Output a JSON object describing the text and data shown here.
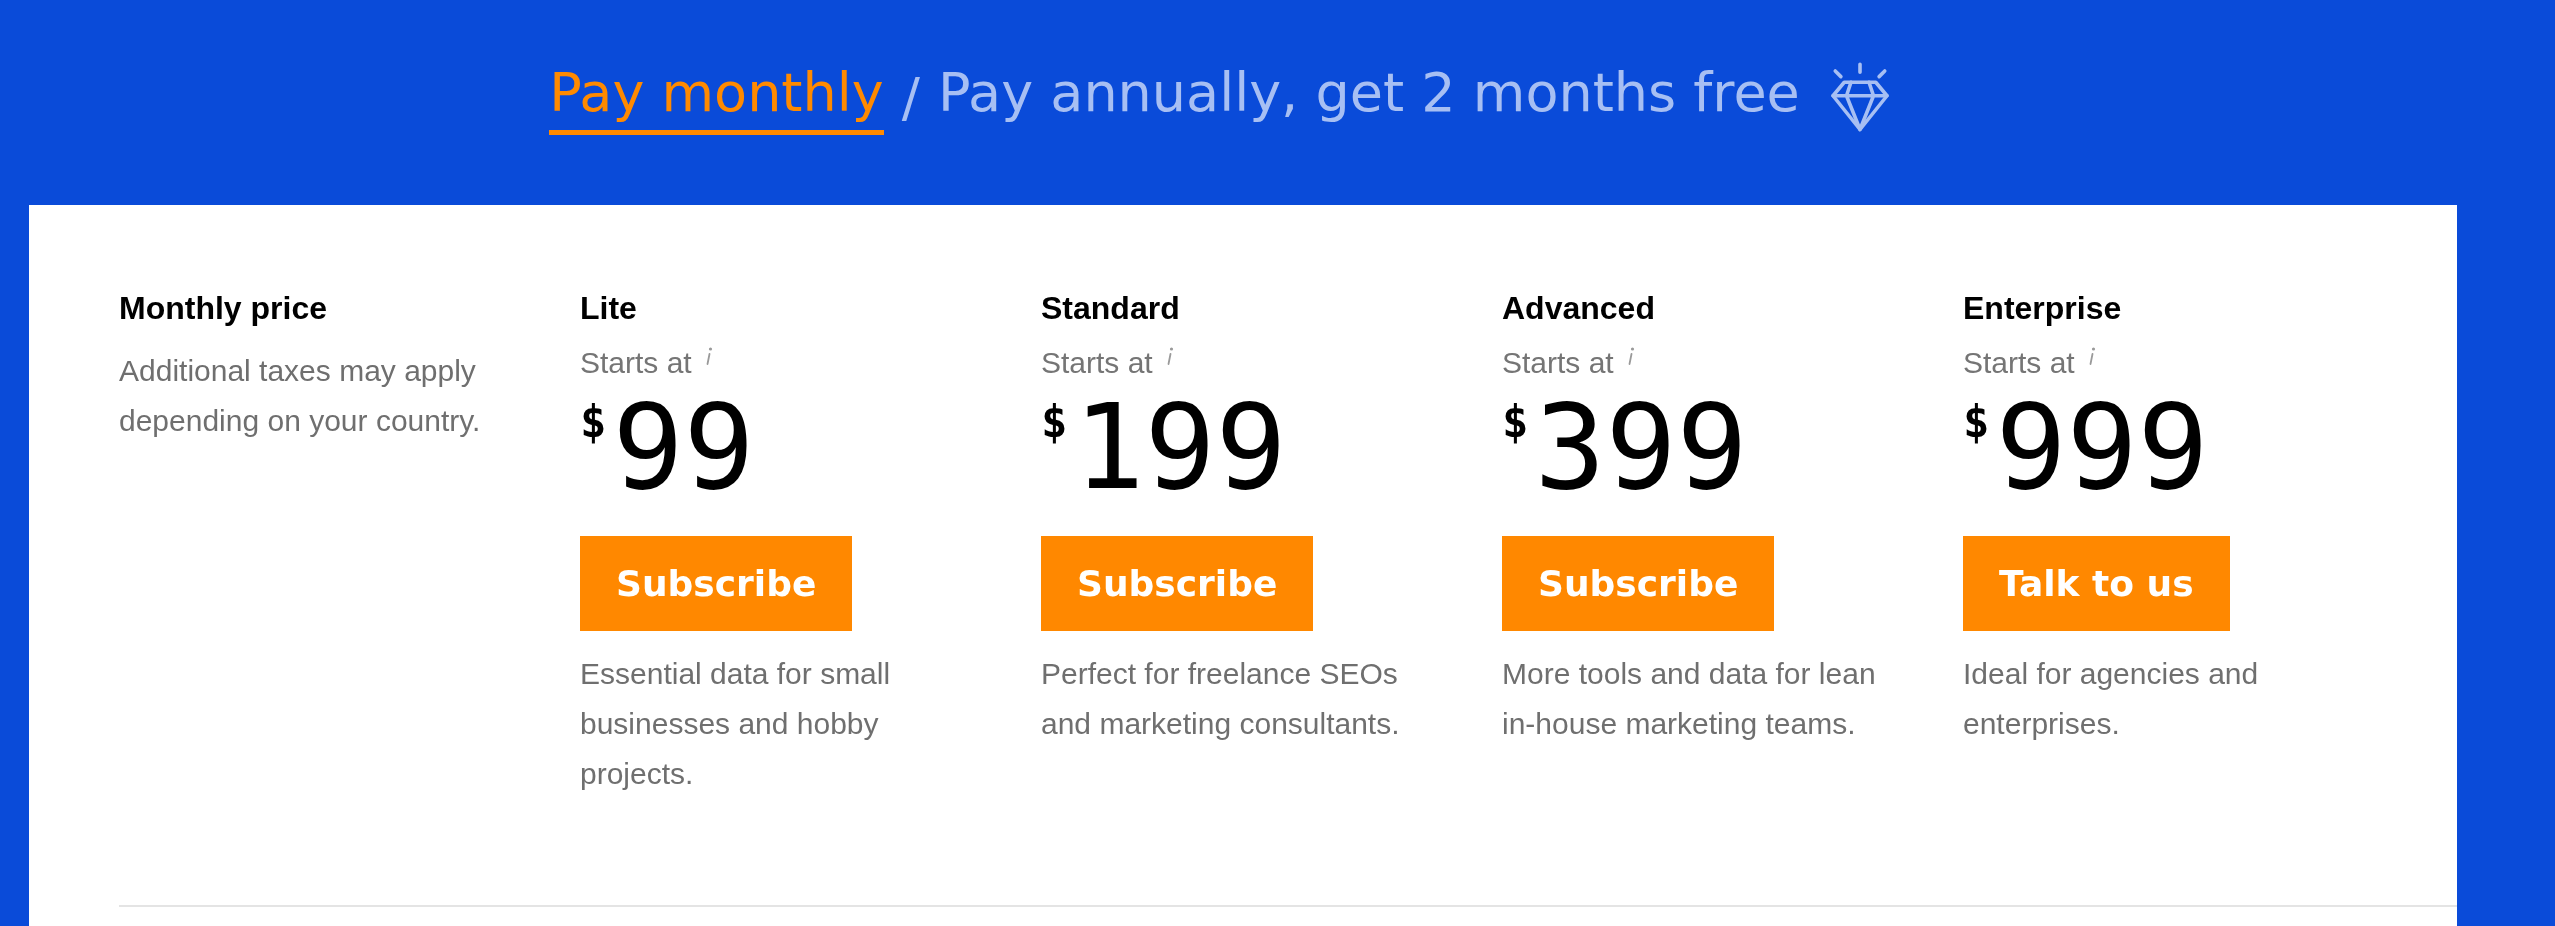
{
  "billing_options": [
    {
      "label": "Pay monthly",
      "selected": true
    },
    {
      "label": "Pay annually, get 2 months free",
      "selected": false
    }
  ],
  "separator": "/",
  "intro": {
    "title": "Monthly price",
    "note": "Additional taxes may apply depending on your country."
  },
  "plans": [
    {
      "name": "Lite",
      "starts_at": "Starts at",
      "currency": "$",
      "price": "99",
      "button": "Subscribe",
      "description": "Essential data for small businesses and hobby projects."
    },
    {
      "name": "Standard",
      "starts_at": "Starts at",
      "currency": "$",
      "price": "199",
      "button": "Subscribe",
      "description": "Perfect for freelance SEOs and marketing consultants."
    },
    {
      "name": "Advanced",
      "starts_at": "Starts at",
      "currency": "$",
      "price": "399",
      "button": "Subscribe",
      "description": "More tools and data for lean in-house marketing teams."
    },
    {
      "name": "Enterprise",
      "starts_at": "Starts at",
      "currency": "$",
      "price": "999",
      "button": "Talk to us",
      "description": "Ideal for agencies and enterprises."
    }
  ]
}
